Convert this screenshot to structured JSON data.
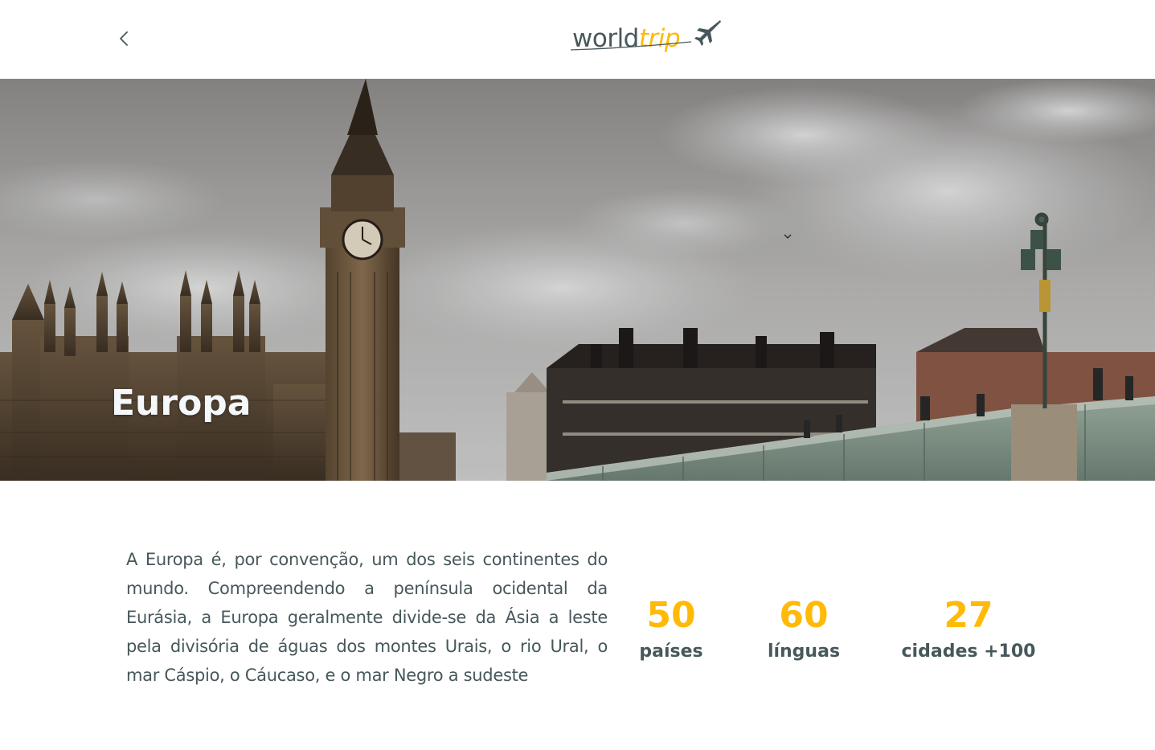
{
  "header": {
    "back_icon": "chevron-left-icon",
    "logo": {
      "part1": "world",
      "part2": "trip",
      "icon": "airplane-icon"
    }
  },
  "banner": {
    "title": "Europa"
  },
  "content": {
    "description": "A Europa é, por convenção, um dos seis continentes do mundo. Compreendendo a península ocidental da Eurásia, a Europa geralmente divide-se da Ásia a leste pela divisória de águas dos montes Urais, o rio Ural, o mar Cáspio, o Cáucaso, e o mar Negro a sudeste",
    "stats": {
      "countries": {
        "value": "50",
        "label": "países"
      },
      "languages": {
        "value": "60",
        "label": "línguas"
      },
      "cities": {
        "value": "27",
        "label": "cidades +100"
      }
    }
  },
  "colors": {
    "accent": "#ffba08",
    "text": "#47585b",
    "light": "#f5f8fa"
  }
}
